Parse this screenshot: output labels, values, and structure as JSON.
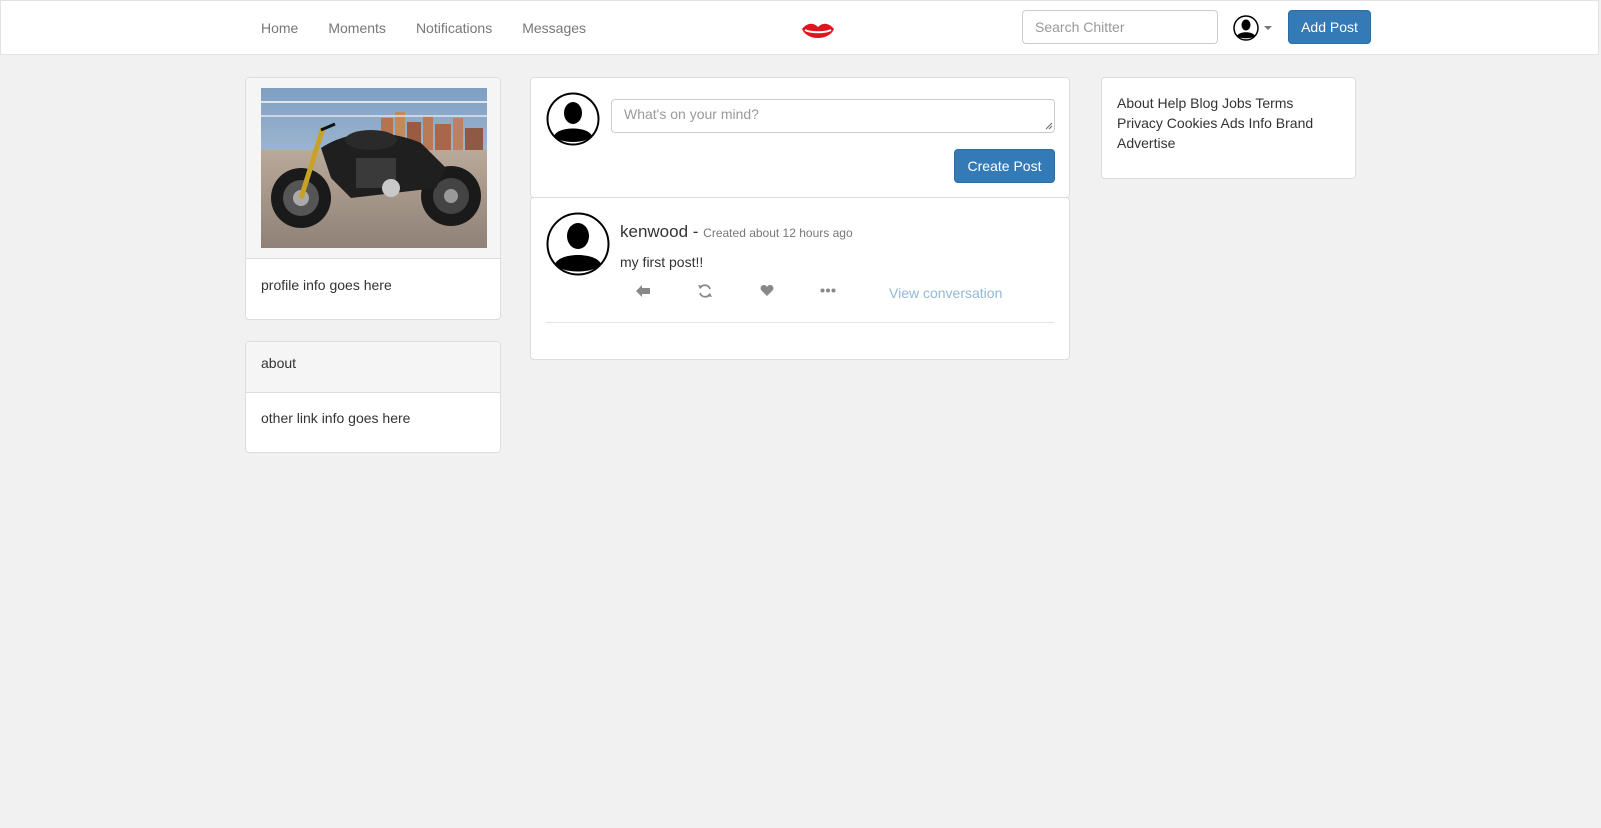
{
  "colors": {
    "accent": "#337ab7",
    "background": "#f1f1f1",
    "logo": "#e0141e",
    "link_muted": "#93b8d7"
  },
  "nav": {
    "items": [
      {
        "label": "Home"
      },
      {
        "label": "Moments"
      },
      {
        "label": "Notifications"
      },
      {
        "label": "Messages"
      }
    ],
    "logo_icon": "lips-icon",
    "search_placeholder": "Search Chitter",
    "user_icon": "user-avatar-icon",
    "add_post_label": "Add Post"
  },
  "profile": {
    "photo_icon": "motorcycle-photo",
    "info": "profile info goes here"
  },
  "about": {
    "title": "about",
    "body": "other link info goes here"
  },
  "compose": {
    "placeholder": "What's on your mind?",
    "button_label": "Create Post"
  },
  "post": {
    "author": "kenwood",
    "separator": " - ",
    "meta": "Created about 12 hours ago",
    "text": "my first post!!",
    "actions": [
      "reply-icon",
      "retweet-icon",
      "heart-icon",
      "more-icon"
    ],
    "view_conversation": "View conversation"
  },
  "footer": {
    "links": [
      "About",
      "Help",
      "Blog",
      "Jobs",
      "Terms",
      "Privacy",
      "Cookies",
      "Ads Info",
      "Brand",
      "Advertise"
    ]
  }
}
